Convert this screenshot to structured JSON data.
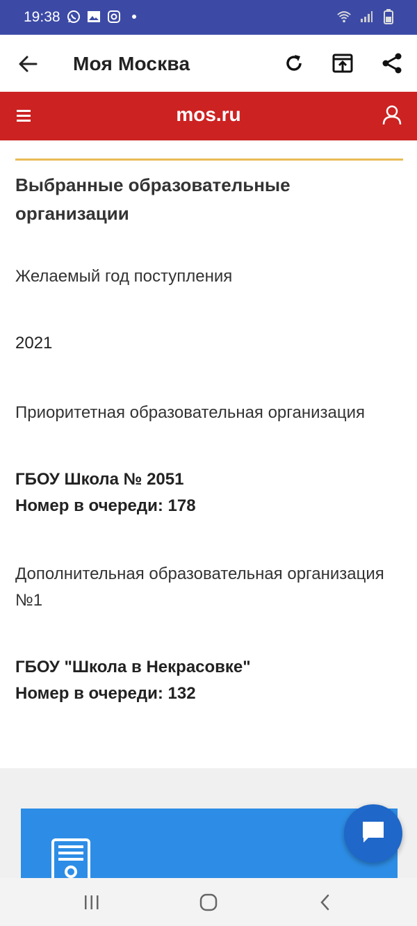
{
  "status_bar": {
    "time": "19:38",
    "left_icons": [
      "whatsapp-icon",
      "image-icon",
      "instagram-icon",
      "dot-icon"
    ],
    "right_icons": [
      "wifi-icon",
      "signal-icon",
      "battery-icon"
    ],
    "background": "#3c4aa6"
  },
  "app_bar": {
    "title": "Моя Москва",
    "actions": [
      "refresh-icon",
      "open-external-icon",
      "share-icon"
    ]
  },
  "site_header": {
    "logo": "mos.ru",
    "background": "#cc2222"
  },
  "content": {
    "section_title": "Выбранные образовательные организации",
    "desired_year_label": "Желаемый год поступления",
    "desired_year_value": "2021",
    "priority_org_label": "Приоритетная образовательная организация",
    "priority_org_name": "ГБОУ Школа № 2051",
    "priority_org_queue": "Номер в очереди: 178",
    "additional_org_label": "Дополнительная образовательная организация №1",
    "additional_org_name": "ГБОУ \"Школа в Некрасовке\"",
    "additional_org_queue": "Номер в очереди: 132"
  },
  "colors": {
    "divider": "#e7bd55",
    "card": "#2d8de6",
    "chat_fab": "#1f67c8"
  },
  "nav_bar": {
    "buttons": [
      "recent-apps-icon",
      "home-icon",
      "back-icon"
    ]
  }
}
